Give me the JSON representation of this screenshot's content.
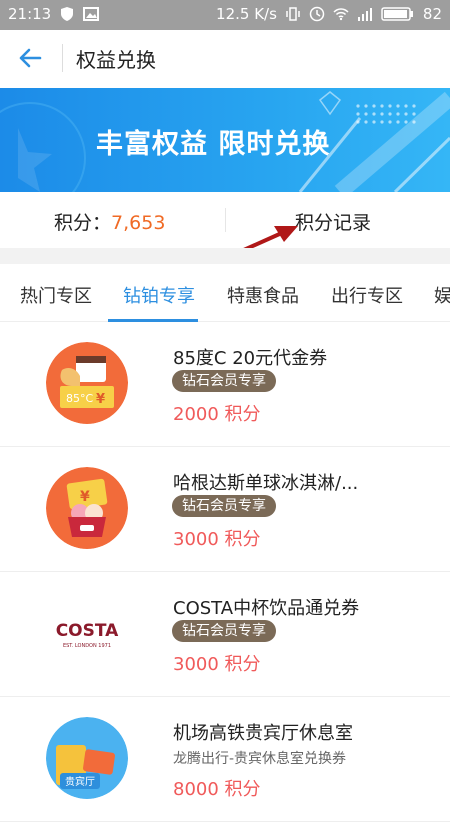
{
  "status_bar": {
    "time": "21:13",
    "network_speed": "12.5 K/s",
    "battery": "82",
    "icons": [
      "shield-icon",
      "image-icon",
      "vibrate-icon",
      "clock-icon",
      "wifi-icon",
      "signal-icon",
      "battery-icon"
    ]
  },
  "header": {
    "title": "权益兑换"
  },
  "banner": {
    "text": "丰富权益 限时兑换"
  },
  "points": {
    "label": "积分：",
    "value": "7,653",
    "record_label": "积分记录"
  },
  "tabs": [
    {
      "label": "热门专区"
    },
    {
      "label": "钻铂专享"
    },
    {
      "label": "特惠食品"
    },
    {
      "label": "出行专区"
    },
    {
      "label": "娱"
    }
  ],
  "active_tab": "钻铂专享",
  "items": [
    {
      "title": "85度C 20元代金券",
      "badge": "钻石会员专享",
      "price": "2000 积分",
      "icon": "coffee-coupon-icon"
    },
    {
      "title": "哈根达斯单球冰淇淋/...",
      "badge": "钻石会员专享",
      "price": "3000 积分",
      "icon": "icecream-coupon-icon"
    },
    {
      "title": "COSTA中杯饮品通兑券",
      "badge": "钻石会员专享",
      "price": "3000 积分",
      "icon": "costa-logo"
    },
    {
      "title": "机场高铁贵宾厅休息室",
      "subtitle": "龙腾出行-贵宾休息室兑换券",
      "price": "8000 积分",
      "icon": "vip-lounge-icon"
    }
  ],
  "images": {
    "item1_logo_text": "85°C",
    "item1_currency": "¥",
    "item2_currency": "¥",
    "costa_logo_text": "COSTA",
    "costa_logo_sub": "EST. LONDON 1971",
    "item4_label": "贵宾厅"
  },
  "colors": {
    "accent_blue": "#2d8fe0",
    "points_orange": "#f06a25",
    "price_red": "#f05a5a",
    "badge_brown": "#7b6a57",
    "costa_red": "#8b1a2b"
  }
}
